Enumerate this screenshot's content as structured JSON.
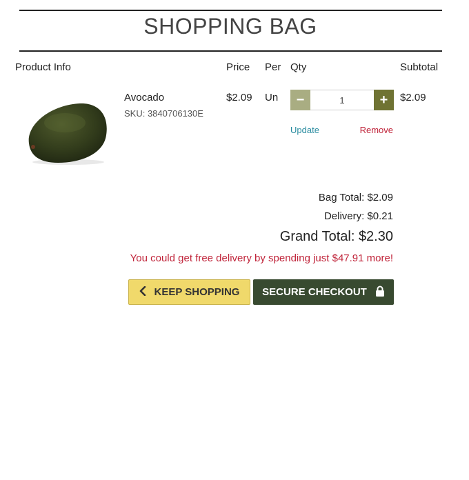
{
  "page": {
    "title": "SHOPPING BAG"
  },
  "table": {
    "headers": {
      "product_info": "Product Info",
      "price": "Price",
      "per": "Per",
      "qty": "Qty",
      "subtotal": "Subtotal"
    }
  },
  "item": {
    "name": "Avocado",
    "sku": "SKU: 3840706130E",
    "price": "$2.09",
    "per": "Un",
    "quantity": "1",
    "subtotal": "$2.09",
    "update_label": "Update",
    "remove_label": "Remove",
    "minus_label": "−",
    "plus_label": "+"
  },
  "totals": {
    "bag_total": "Bag Total: $2.09",
    "delivery": "Delivery: $0.21",
    "grand_total": "Grand Total: $2.30",
    "free_delivery_message": "You could get free delivery by spending just $47.91 more!"
  },
  "actions": {
    "keep_shopping_label": "KEEP SHOPPING",
    "keep_shopping_icon": "chevron-left-icon",
    "checkout_label": "SECURE CHECKOUT",
    "checkout_icon": "lock-icon"
  },
  "colors": {
    "keep_shopping_bg": "#f0d96b",
    "checkout_bg": "#384a30",
    "qty_minus_bg": "#a9ad82",
    "qty_plus_bg": "#6f7333",
    "link_update": "#2a8ca0",
    "alert_red": "#c0243a"
  }
}
